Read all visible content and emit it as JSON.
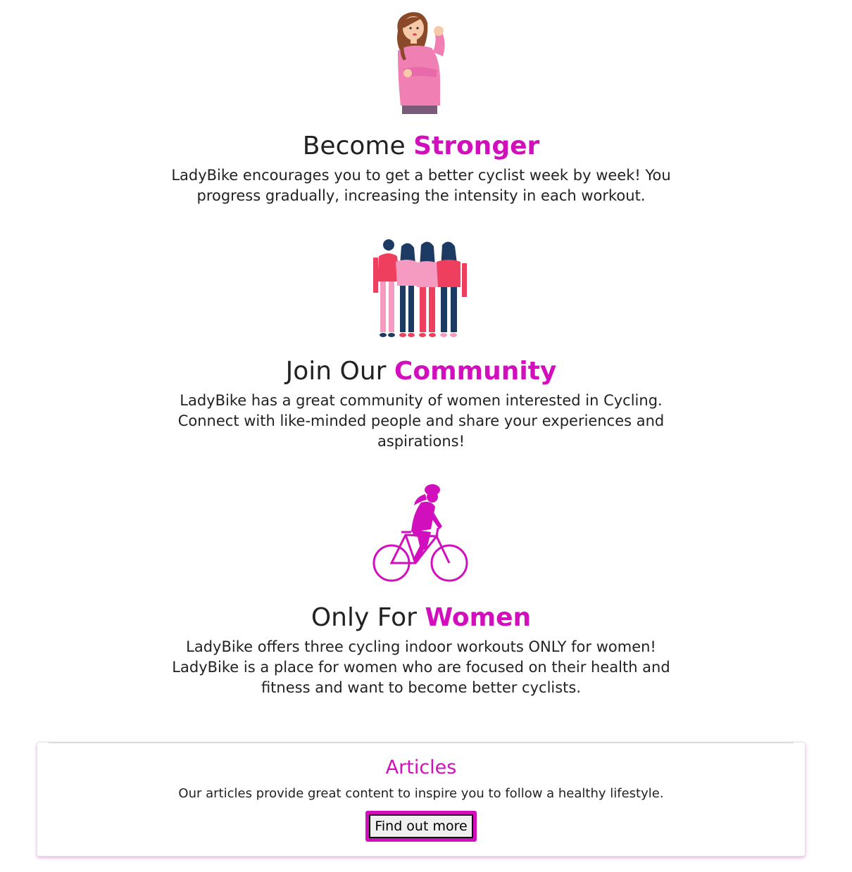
{
  "features": [
    {
      "heading_plain": "Become",
      "heading_accent": "Stronger",
      "text": "LadyBike encourages you to get a better cyclist week by week! You progress gradually, increasing the intensity in each workout.",
      "illustration": "flexing-woman-illustration"
    },
    {
      "heading_plain": "Join Our",
      "heading_accent": "Community",
      "text": "LadyBike has a great community of women interested in Cycling. Connect with like-minded people and share your experiences and aspirations!",
      "illustration": "women-group-illustration"
    },
    {
      "heading_plain": "Only For",
      "heading_accent": "Women",
      "text": "LadyBike offers three cycling indoor workouts ONLY for women! LadyBike is a place for women who are focused on their health and fitness and want to become better cyclists.",
      "illustration": "woman-cyclist-illustration"
    }
  ],
  "articles_card": {
    "title": "Articles",
    "text": "Our articles provide great content to inspire you to follow a healthy lifestyle.",
    "button_label": "Find out more"
  },
  "colors": {
    "accent": "#d10fbd",
    "text": "#222222",
    "pink": "#f080b8",
    "navy": "#1d3a63",
    "red": "#ef3f5e"
  }
}
